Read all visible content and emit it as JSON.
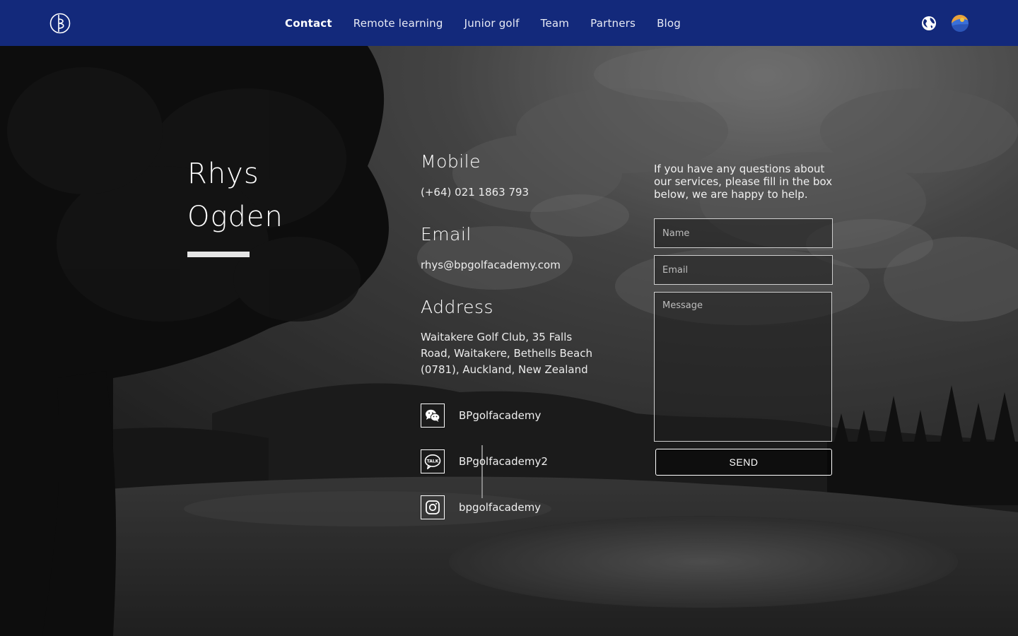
{
  "nav": {
    "items": [
      {
        "label": "Contact",
        "active": true
      },
      {
        "label": "Remote learning"
      },
      {
        "label": "Junior golf"
      },
      {
        "label": "Team"
      },
      {
        "label": "Partners"
      },
      {
        "label": "Blog"
      }
    ],
    "background": "#13297b",
    "icons": [
      "logo-icon",
      "globe-icon",
      "language-flag-icon"
    ]
  },
  "profile": {
    "first_name": "Rhys",
    "last_name": "Ogden"
  },
  "contact": {
    "mobile_title": "Mobile",
    "mobile": "(+64) 021 1863 793",
    "email_title": "Email",
    "email": "rhys@bpgolfacademy.com",
    "address_title": "Address",
    "address": "Waitakere Golf Club, 35 Falls Road, Waitakere, Bethells Beach (0781), Auckland, New Zealand"
  },
  "social": [
    {
      "icon": "wechat-icon",
      "label": "BPgolfacademy"
    },
    {
      "icon": "kakaotalk-icon",
      "label": "BPgolfacademy2"
    },
    {
      "icon": "instagram-icon",
      "label": "bpgolfacademy"
    }
  ],
  "form": {
    "intro": "If you have any questions about our services, please fill in the box below, we are happy to help.",
    "name_placeholder": "Name",
    "email_placeholder": "Email",
    "message_placeholder": "Message",
    "send_label": "SEND"
  }
}
